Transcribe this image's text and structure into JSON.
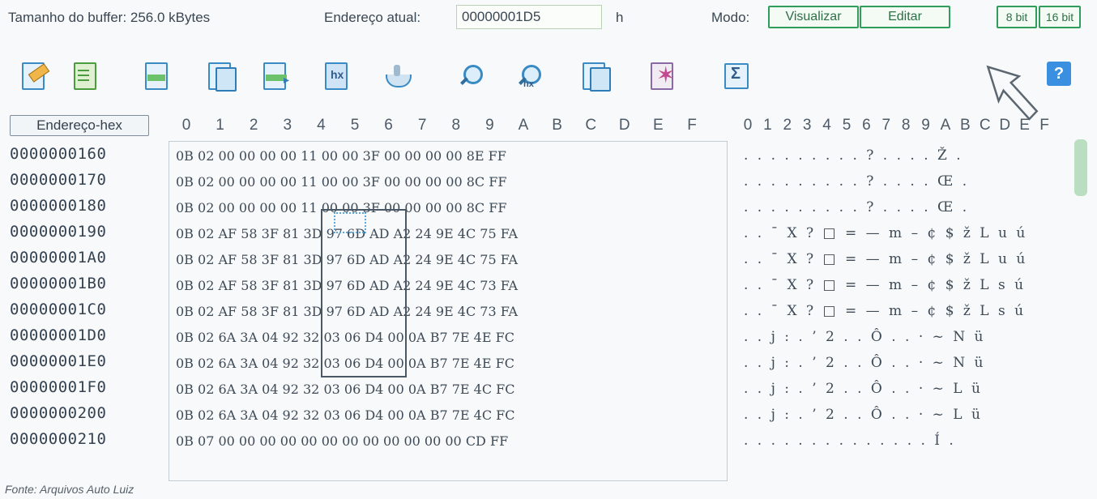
{
  "topbar": {
    "buffer_label": "Tamanho do buffer: 256.0 kBytes",
    "address_label": "Endereço atual:",
    "address_value": "00000001D5",
    "address_suffix": "h",
    "mode_label": "Modo:",
    "view_button": "Visualizar",
    "edit_button": "Editar",
    "bit8_button": "8 bit",
    "bit16_button": "16 bit"
  },
  "toolbar": {
    "icons": [
      "edit-icon",
      "new-file-icon",
      "image-icon",
      "copy-icon",
      "export-icon",
      "hex-file-icon",
      "eject-icon",
      "search-icon",
      "search-hex-icon",
      "copy-window-icon",
      "mark-icon",
      "sum-icon"
    ],
    "help_label": "?"
  },
  "editor": {
    "address_header": "Endereço-hex",
    "hex_columns": [
      "0",
      "1",
      "2",
      "3",
      "4",
      "5",
      "6",
      "7",
      "8",
      "9",
      "A",
      "B",
      "C",
      "D",
      "E",
      "F"
    ],
    "ascii_columns": [
      "0",
      "1",
      "2",
      "3",
      "4",
      "5",
      "6",
      "7",
      "8",
      "9",
      "A",
      "B",
      "C",
      "D",
      "E",
      "F"
    ],
    "rows": [
      {
        "addr": "0000000160",
        "hex": "0B 02 00 00 00 00 11 00 00 3F 00 00 00 00 8E FF",
        "ascii": ". . . . . . . . . ? . . . . Ž ."
      },
      {
        "addr": "0000000170",
        "hex": "0B 02 00 00 00 00 11 00 00 3F 00 00 00 00 8C FF",
        "ascii": ". . . . . . . . . ? . . . . Œ ."
      },
      {
        "addr": "0000000180",
        "hex": "0B 02 00 00 00 00 11 00 00 3F 00 00 00 00 8C FF",
        "ascii": ". . . . . . . . . ? . . . . Œ ."
      },
      {
        "addr": "0000000190",
        "hex": "0B 02 AF 58 3F 81 3D 97 6D AD A2 24 9E 4C 75 FA",
        "ascii": ". . ¯ X ? □ = — m – ¢ $ ž L u ú"
      },
      {
        "addr": "00000001A0",
        "hex": "0B 02 AF 58 3F 81 3D 97 6D AD A2 24 9E 4C 75 FA",
        "ascii": ". . ¯ X ? □ = — m – ¢ $ ž L u ú"
      },
      {
        "addr": "00000001B0",
        "hex": "0B 02 AF 58 3F 81 3D 97 6D AD A2 24 9E 4C 73 FA",
        "ascii": ". . ¯ X ? □ = — m – ¢ $ ž L s ú"
      },
      {
        "addr": "00000001C0",
        "hex": "0B 02 AF 58 3F 81 3D 97 6D AD A2 24 9E 4C 73 FA",
        "ascii": ". . ¯ X ? □ = — m – ¢ $ ž L s ú"
      },
      {
        "addr": "00000001D0",
        "hex": "0B 02 6A 3A 04 92 32 03 06 D4 00 0A B7 7E 4E FC",
        "ascii": ". . j : . ’ 2 . . Ô . . · ~ N ü"
      },
      {
        "addr": "00000001E0",
        "hex": "0B 02 6A 3A 04 92 32 03 06 D4 00 0A B7 7E 4E FC",
        "ascii": ". . j : . ’ 2 . . Ô . . · ~ N ü"
      },
      {
        "addr": "00000001F0",
        "hex": "0B 02 6A 3A 04 92 32 03 06 D4 00 0A B7 7E 4C FC",
        "ascii": ". . j : . ’ 2 . . Ô . . · ~ L ü"
      },
      {
        "addr": "0000000200",
        "hex": "0B 02 6A 3A 04 92 32 03 06 D4 00 0A B7 7E 4C FC",
        "ascii": ". . j : . ’ 2 . . Ô . . · ~ L ü"
      },
      {
        "addr": "0000000210",
        "hex": "0B 07 00 00 00 00 00 00 00 00 00 00 00 00 CD FF",
        "ascii": ". . . . . . . . . . . . . . Í ."
      }
    ]
  },
  "footer": {
    "source": "Fonte: Arquivos Auto Luiz"
  }
}
